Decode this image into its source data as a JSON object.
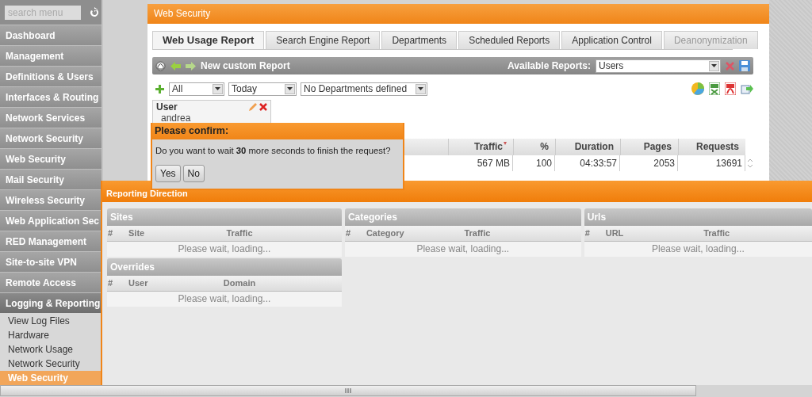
{
  "sidebar": {
    "search": {
      "placeholder": "search menu"
    },
    "items": [
      {
        "label": "Dashboard",
        "expanded": false
      },
      {
        "label": "Management",
        "expanded": false
      },
      {
        "label": "Definitions & Users",
        "expanded": false
      },
      {
        "label": "Interfaces & Routing",
        "expanded": false
      },
      {
        "label": "Network Services",
        "expanded": false
      },
      {
        "label": "Network Security",
        "expanded": false
      },
      {
        "label": "Web Security",
        "expanded": false
      },
      {
        "label": "Mail Security",
        "expanded": false
      },
      {
        "label": "Wireless Security",
        "expanded": false
      },
      {
        "label": "Web Application Sec",
        "expanded": false
      },
      {
        "label": "RED Management",
        "expanded": false
      },
      {
        "label": "Site-to-site VPN",
        "expanded": false
      },
      {
        "label": "Remote Access",
        "expanded": false
      },
      {
        "label": "Logging & Reporting",
        "expanded": true,
        "children": [
          {
            "label": "View Log Files",
            "selected": false
          },
          {
            "label": "Hardware",
            "selected": false
          },
          {
            "label": "Network Usage",
            "selected": false
          },
          {
            "label": "Network Security",
            "selected": false
          },
          {
            "label": "Web Security",
            "selected": true
          }
        ]
      }
    ]
  },
  "page_title": "Web Security",
  "tabs": [
    {
      "label": "Web Usage Report",
      "selected": true,
      "disabled": false
    },
    {
      "label": "Search Engine Report",
      "selected": false,
      "disabled": false
    },
    {
      "label": "Departments",
      "selected": false,
      "disabled": false
    },
    {
      "label": "Scheduled Reports",
      "selected": false,
      "disabled": false
    },
    {
      "label": "Application Control",
      "selected": false,
      "disabled": false
    },
    {
      "label": "Deanonymization",
      "selected": false,
      "disabled": true
    }
  ],
  "toolbar": {
    "title": "New custom Report",
    "reports_label": "Available Reports:",
    "reports_value": "Users"
  },
  "filters": [
    {
      "value": "All"
    },
    {
      "value": "Today"
    },
    {
      "value": "No Departments defined"
    }
  ],
  "filter_card": {
    "title": "User",
    "value": "andrea"
  },
  "table": {
    "columns": [
      {
        "label": "Traffic",
        "sorted": true
      },
      {
        "label": "%",
        "sorted": false
      },
      {
        "label": "Duration",
        "sorted": false
      },
      {
        "label": "Pages",
        "sorted": false
      },
      {
        "label": "Requests",
        "sorted": false
      }
    ],
    "rows": [
      {
        "cells": [
          "567 MB",
          "100",
          "04:33:57",
          "2053",
          "13691"
        ]
      }
    ]
  },
  "report_window": {
    "title": "Reporting Direction",
    "panels": [
      {
        "title": "Sites",
        "columns": [
          "#",
          "Site",
          "Traffic"
        ],
        "message": "Please wait, loading..."
      },
      {
        "title": "Overrides",
        "columns": [
          "#",
          "User",
          "Domain"
        ],
        "message": "Please wait, loading..."
      },
      {
        "title": "Categories",
        "columns": [
          "#",
          "Category",
          "Traffic"
        ],
        "message": "Please wait, loading..."
      },
      {
        "title": "Urls",
        "columns": [
          "#",
          "URL",
          "Traffic"
        ],
        "message": "Please wait, loading..."
      }
    ]
  },
  "dialog": {
    "title": "Please confirm:",
    "message": "Do you want to wait **30** more seconds to finish the request?",
    "buttons": [
      "Yes",
      "No"
    ]
  }
}
